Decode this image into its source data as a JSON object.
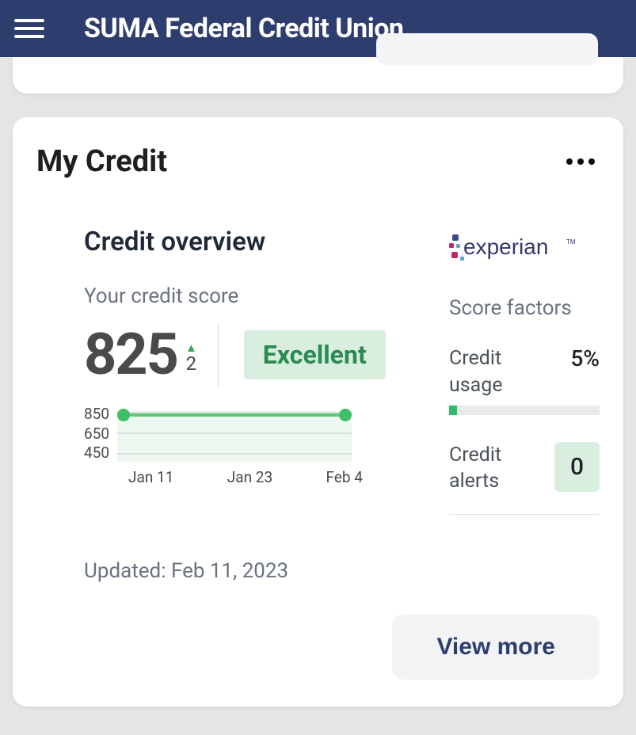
{
  "header": {
    "title": "SUMA Federal Credit Union"
  },
  "card": {
    "title": "My Credit",
    "overview_title": "Credit overview",
    "subtitle": "Your credit score",
    "score": "825",
    "score_change": "2",
    "rating": "Excellent",
    "updated_prefix": "Updated: ",
    "updated_date": "Feb 11, 2023",
    "view_more": "View more"
  },
  "factors": {
    "title": "Score factors",
    "usage_label": "Credit usage",
    "usage_value": "5%",
    "alerts_label": "Credit alerts",
    "alerts_value": "0"
  },
  "chart_data": {
    "type": "line",
    "x": [
      "Jan 11",
      "Jan 23",
      "Feb 4"
    ],
    "y_ticks": [
      850,
      650,
      450
    ],
    "values": [
      825,
      825,
      825
    ],
    "ylim": [
      450,
      850
    ],
    "title": "",
    "xlabel": "",
    "ylabel": ""
  },
  "logo": {
    "text": "experian"
  }
}
